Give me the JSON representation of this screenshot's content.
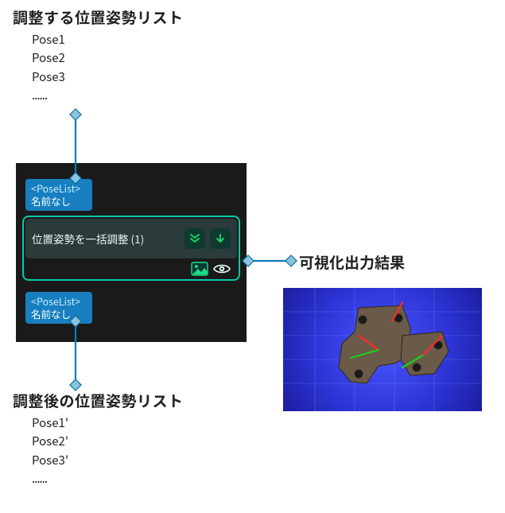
{
  "input": {
    "heading": "調整する位置姿勢リスト",
    "items": [
      "Pose1",
      "Pose2",
      "Pose3"
    ],
    "ellipsis": "......"
  },
  "output": {
    "heading": "調整後の位置姿勢リスト",
    "items": [
      "Pose1'",
      "Pose2'",
      "Pose3'"
    ],
    "ellipsis": "......"
  },
  "node": {
    "port_in": {
      "type": "<PoseList>",
      "name": "名前なし"
    },
    "port_out": {
      "type": "<PoseList>",
      "name": "名前なし"
    },
    "title": "位置姿勢を一括調整 (1)"
  },
  "viz": {
    "label": "可視化出力結果"
  },
  "colors": {
    "port_blue": "#177fbf",
    "node_border": "#06c8a8",
    "icon_fg": "#18d067",
    "connector": "#0077b3"
  }
}
